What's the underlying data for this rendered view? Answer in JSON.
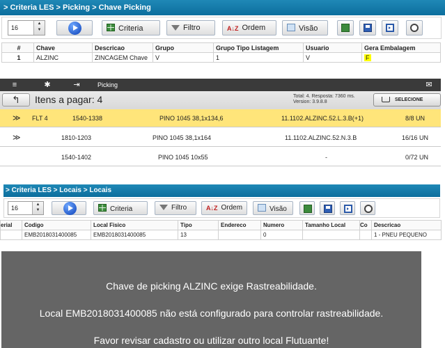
{
  "panel1": {
    "breadcrumb": "> Criteria LES > Picking > Chave Picking",
    "toolbar": {
      "page_size": "16",
      "criteria": "Criteria",
      "filtro": "Filtro",
      "ordem": "Ordem",
      "visao": "Visão",
      "sort_glyph": "A↓Z"
    },
    "columns": [
      "#",
      "Chave",
      "Descricao",
      "Grupo",
      "Grupo Tipo Listagem",
      "Usuario",
      "Gera Embalagem"
    ],
    "row": {
      "num": "1",
      "chave": "ALZINC",
      "descricao": "ZINCAGEM Chave",
      "grupo": "V",
      "grupo_tipo": "1",
      "usuario": "V",
      "gera_embalagem": "F"
    }
  },
  "panel2": {
    "topbar": {
      "title": "Picking",
      "menu_icon": "≡",
      "gear_icon": "✱",
      "exit_icon": "⇥",
      "mail_icon": "✉"
    },
    "back_label": "↰",
    "heading": "Itens a pagar: 4",
    "stats_line1": "Total: 4. Resposta: 7360 ms.",
    "stats_line2": "Version: 3.9.8.8",
    "select_label": "SELECIONE",
    "rows": [
      {
        "check": "≫",
        "flt": "FLT 4",
        "code": "1540-1338",
        "desc": "PINO 1045 38,1x134,6",
        "loc": "11.1102.ALZINC.52.L.3.B(+1)",
        "qty": "8/8 UN"
      },
      {
        "check": "≫",
        "flt": "",
        "code": "1810-1203",
        "desc": "PINO 1045 38,1x164",
        "loc": "11.1102.ALZINC.52.N.3.B",
        "qty": "16/16 UN"
      },
      {
        "check": "",
        "flt": "",
        "code": "1540-1402",
        "desc": "PINO 1045 10x55",
        "loc": "-",
        "qty": "0/72 UN"
      }
    ]
  },
  "panel3": {
    "breadcrumb": "> Criteria LES > Locais > Locais",
    "toolbar": {
      "page_size": "16",
      "criteria": "Criteria",
      "filtro": "Filtro",
      "ordem": "Ordem",
      "visao": "Visão",
      "sort_glyph": "A↓Z"
    },
    "columns": [
      "erial",
      "Codigo",
      "Local Fisico",
      "Tipo",
      "Endereco",
      "Numero",
      "Tamanho Local",
      "Co",
      "Descricao"
    ],
    "row": {
      "serial": "",
      "codigo": "EMB2018031400085",
      "local_fisico": "EMB2018031400085",
      "tipo": "13",
      "endereco": "",
      "numero": "0",
      "tamanho": "",
      "co": "",
      "descricao": "1 - PNEU PEQUENO"
    }
  },
  "message": {
    "line1": "Chave de picking ALZINC exige Rastreabilidade.",
    "line2": "Local EMB2018031400085 não está configurado para controlar rastreabilidade.",
    "line3": "Favor revisar cadastro ou utilizar outro local Flutuante!"
  }
}
